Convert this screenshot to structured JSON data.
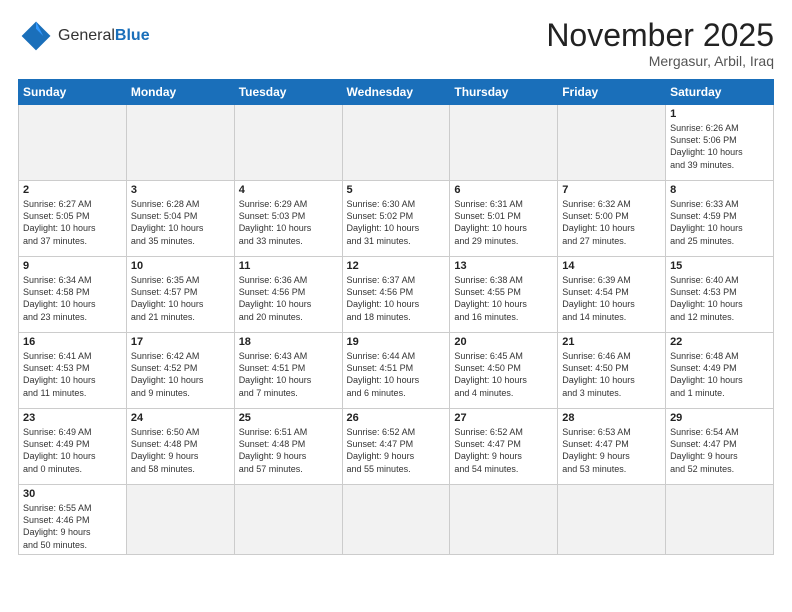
{
  "header": {
    "logo_general": "General",
    "logo_blue": "Blue",
    "month_year": "November 2025",
    "location": "Mergasur, Arbil, Iraq"
  },
  "days_of_week": [
    "Sunday",
    "Monday",
    "Tuesday",
    "Wednesday",
    "Thursday",
    "Friday",
    "Saturday"
  ],
  "weeks": [
    [
      {
        "day": "",
        "text": ""
      },
      {
        "day": "",
        "text": ""
      },
      {
        "day": "",
        "text": ""
      },
      {
        "day": "",
        "text": ""
      },
      {
        "day": "",
        "text": ""
      },
      {
        "day": "",
        "text": ""
      },
      {
        "day": "1",
        "text": "Sunrise: 6:26 AM\nSunset: 5:06 PM\nDaylight: 10 hours\nand 39 minutes."
      }
    ],
    [
      {
        "day": "2",
        "text": "Sunrise: 6:27 AM\nSunset: 5:05 PM\nDaylight: 10 hours\nand 37 minutes."
      },
      {
        "day": "3",
        "text": "Sunrise: 6:28 AM\nSunset: 5:04 PM\nDaylight: 10 hours\nand 35 minutes."
      },
      {
        "day": "4",
        "text": "Sunrise: 6:29 AM\nSunset: 5:03 PM\nDaylight: 10 hours\nand 33 minutes."
      },
      {
        "day": "5",
        "text": "Sunrise: 6:30 AM\nSunset: 5:02 PM\nDaylight: 10 hours\nand 31 minutes."
      },
      {
        "day": "6",
        "text": "Sunrise: 6:31 AM\nSunset: 5:01 PM\nDaylight: 10 hours\nand 29 minutes."
      },
      {
        "day": "7",
        "text": "Sunrise: 6:32 AM\nSunset: 5:00 PM\nDaylight: 10 hours\nand 27 minutes."
      },
      {
        "day": "8",
        "text": "Sunrise: 6:33 AM\nSunset: 4:59 PM\nDaylight: 10 hours\nand 25 minutes."
      }
    ],
    [
      {
        "day": "9",
        "text": "Sunrise: 6:34 AM\nSunset: 4:58 PM\nDaylight: 10 hours\nand 23 minutes."
      },
      {
        "day": "10",
        "text": "Sunrise: 6:35 AM\nSunset: 4:57 PM\nDaylight: 10 hours\nand 21 minutes."
      },
      {
        "day": "11",
        "text": "Sunrise: 6:36 AM\nSunset: 4:56 PM\nDaylight: 10 hours\nand 20 minutes."
      },
      {
        "day": "12",
        "text": "Sunrise: 6:37 AM\nSunset: 4:56 PM\nDaylight: 10 hours\nand 18 minutes."
      },
      {
        "day": "13",
        "text": "Sunrise: 6:38 AM\nSunset: 4:55 PM\nDaylight: 10 hours\nand 16 minutes."
      },
      {
        "day": "14",
        "text": "Sunrise: 6:39 AM\nSunset: 4:54 PM\nDaylight: 10 hours\nand 14 minutes."
      },
      {
        "day": "15",
        "text": "Sunrise: 6:40 AM\nSunset: 4:53 PM\nDaylight: 10 hours\nand 12 minutes."
      }
    ],
    [
      {
        "day": "16",
        "text": "Sunrise: 6:41 AM\nSunset: 4:53 PM\nDaylight: 10 hours\nand 11 minutes."
      },
      {
        "day": "17",
        "text": "Sunrise: 6:42 AM\nSunset: 4:52 PM\nDaylight: 10 hours\nand 9 minutes."
      },
      {
        "day": "18",
        "text": "Sunrise: 6:43 AM\nSunset: 4:51 PM\nDaylight: 10 hours\nand 7 minutes."
      },
      {
        "day": "19",
        "text": "Sunrise: 6:44 AM\nSunset: 4:51 PM\nDaylight: 10 hours\nand 6 minutes."
      },
      {
        "day": "20",
        "text": "Sunrise: 6:45 AM\nSunset: 4:50 PM\nDaylight: 10 hours\nand 4 minutes."
      },
      {
        "day": "21",
        "text": "Sunrise: 6:46 AM\nSunset: 4:50 PM\nDaylight: 10 hours\nand 3 minutes."
      },
      {
        "day": "22",
        "text": "Sunrise: 6:48 AM\nSunset: 4:49 PM\nDaylight: 10 hours\nand 1 minute."
      }
    ],
    [
      {
        "day": "23",
        "text": "Sunrise: 6:49 AM\nSunset: 4:49 PM\nDaylight: 10 hours\nand 0 minutes."
      },
      {
        "day": "24",
        "text": "Sunrise: 6:50 AM\nSunset: 4:48 PM\nDaylight: 9 hours\nand 58 minutes."
      },
      {
        "day": "25",
        "text": "Sunrise: 6:51 AM\nSunset: 4:48 PM\nDaylight: 9 hours\nand 57 minutes."
      },
      {
        "day": "26",
        "text": "Sunrise: 6:52 AM\nSunset: 4:47 PM\nDaylight: 9 hours\nand 55 minutes."
      },
      {
        "day": "27",
        "text": "Sunrise: 6:52 AM\nSunset: 4:47 PM\nDaylight: 9 hours\nand 54 minutes."
      },
      {
        "day": "28",
        "text": "Sunrise: 6:53 AM\nSunset: 4:47 PM\nDaylight: 9 hours\nand 53 minutes."
      },
      {
        "day": "29",
        "text": "Sunrise: 6:54 AM\nSunset: 4:47 PM\nDaylight: 9 hours\nand 52 minutes."
      }
    ],
    [
      {
        "day": "30",
        "text": "Sunrise: 6:55 AM\nSunset: 4:46 PM\nDaylight: 9 hours\nand 50 minutes."
      },
      {
        "day": "",
        "text": ""
      },
      {
        "day": "",
        "text": ""
      },
      {
        "day": "",
        "text": ""
      },
      {
        "day": "",
        "text": ""
      },
      {
        "day": "",
        "text": ""
      },
      {
        "day": "",
        "text": ""
      }
    ]
  ]
}
